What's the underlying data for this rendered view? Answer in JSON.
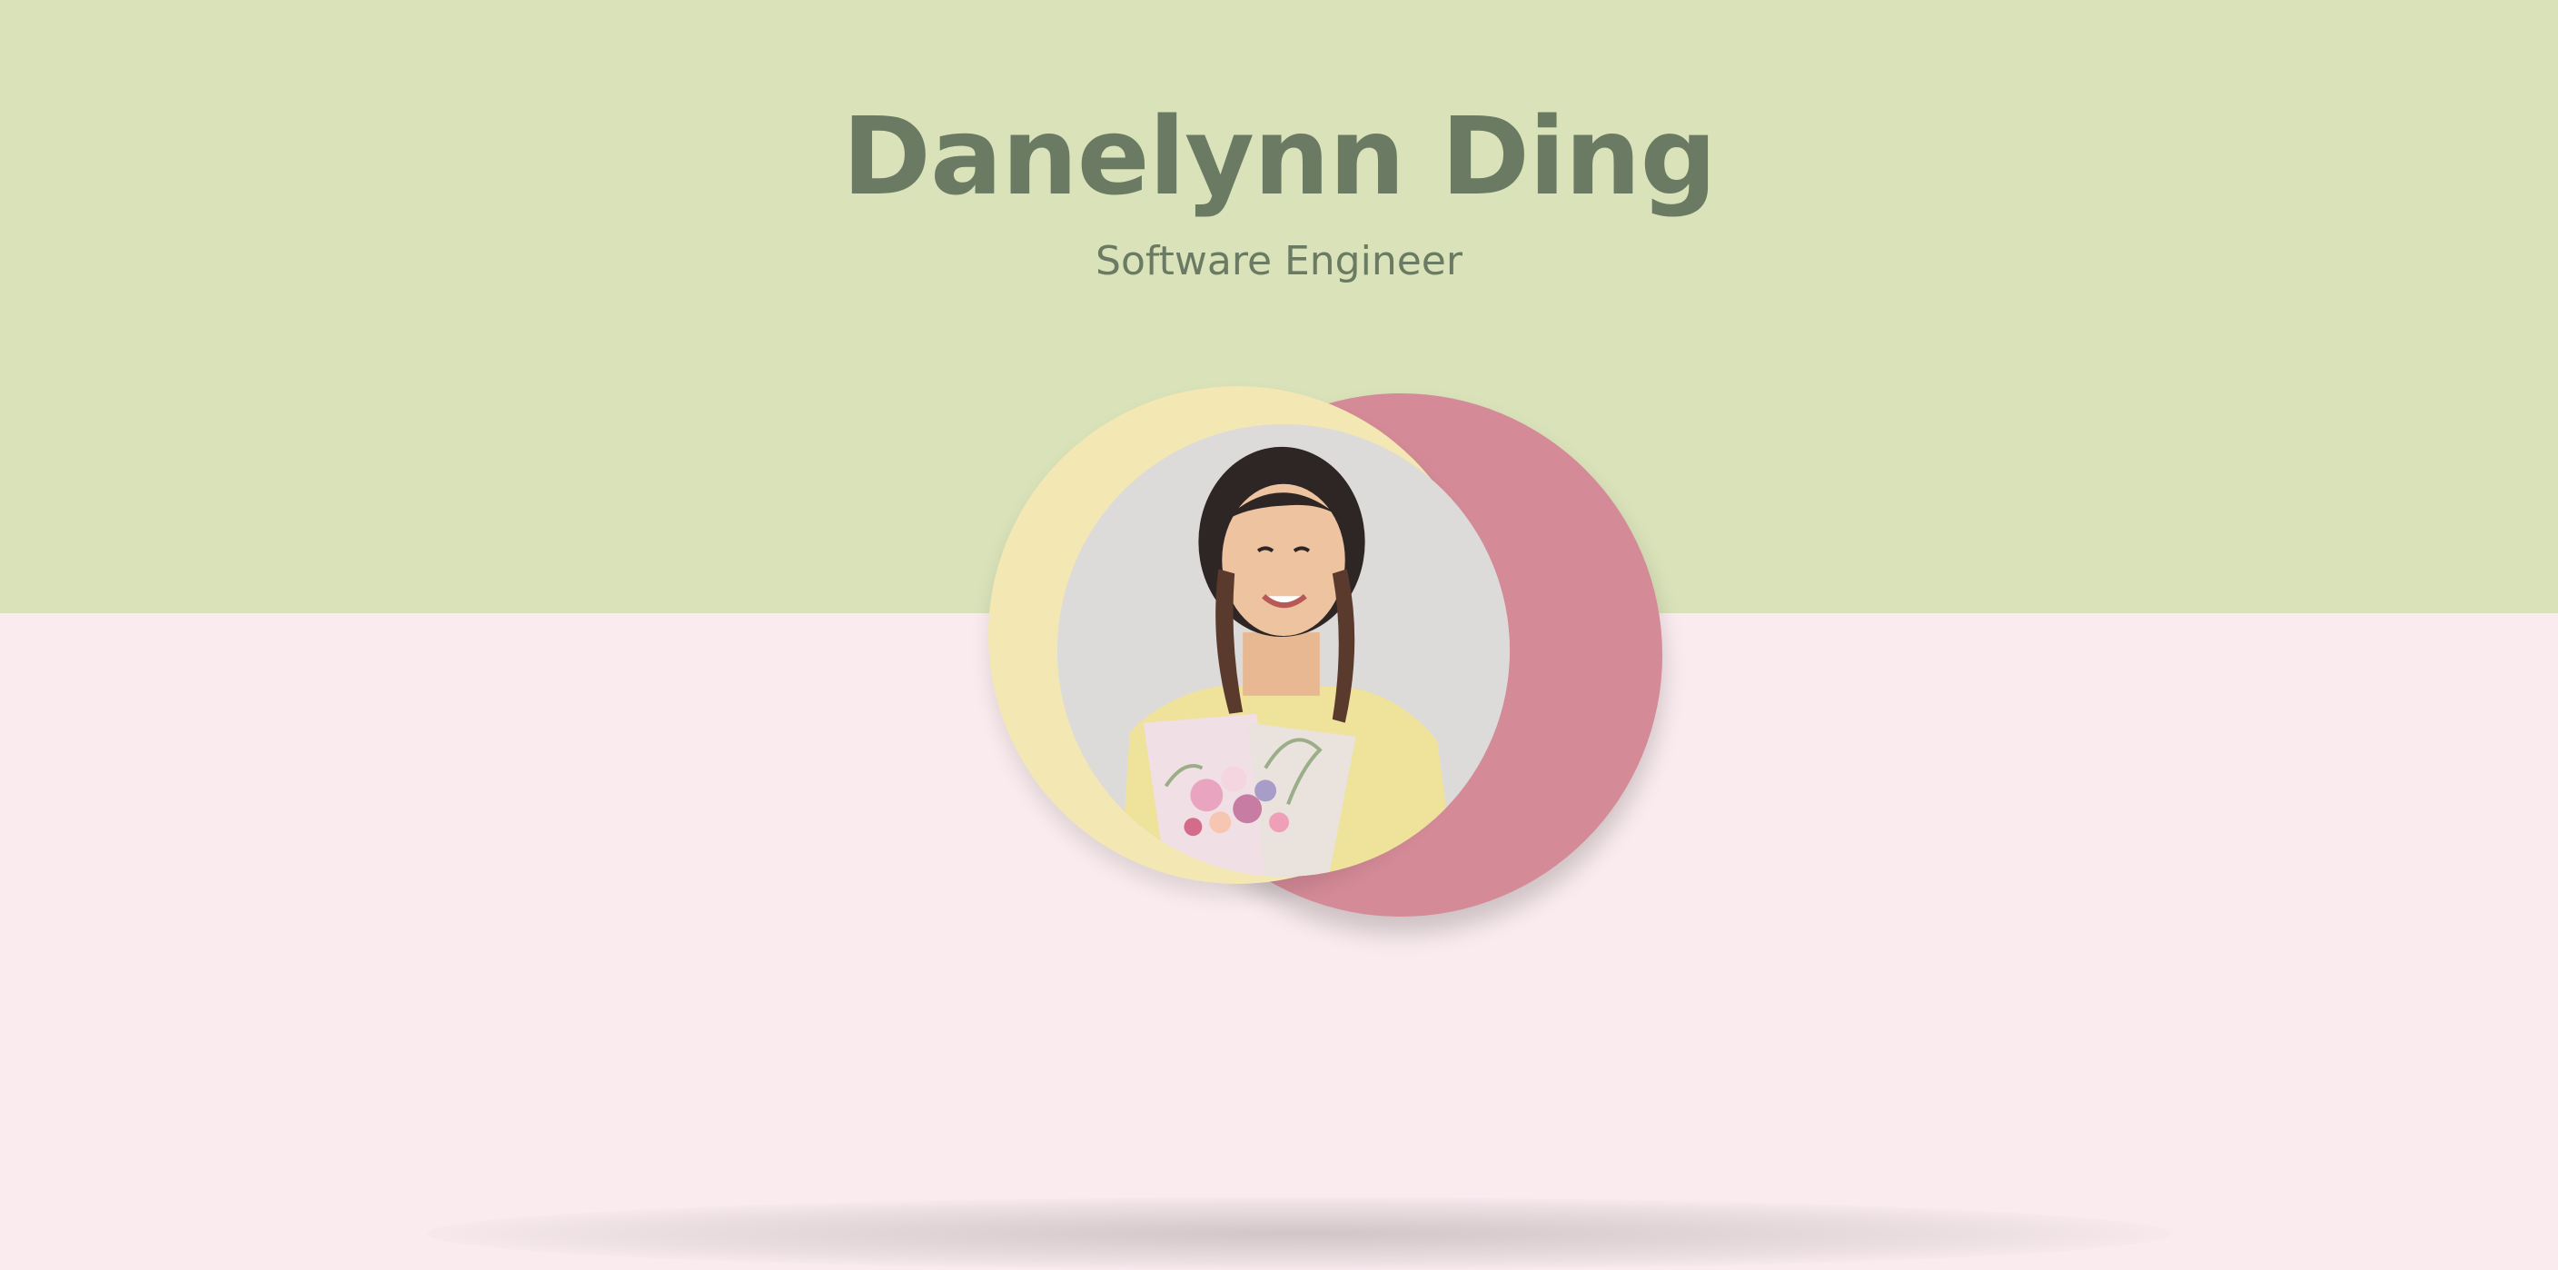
{
  "header": {
    "name": "Danelynn Ding",
    "title": "Software Engineer"
  },
  "avatar": {
    "icon": "profile-photo",
    "ring_colors": {
      "outer": "#d48a97",
      "inner": "#f3e7b3"
    }
  },
  "colors": {
    "hero_background": "#d9e2b9",
    "page_background": "#f9ebee",
    "text": "#6a7a63"
  }
}
